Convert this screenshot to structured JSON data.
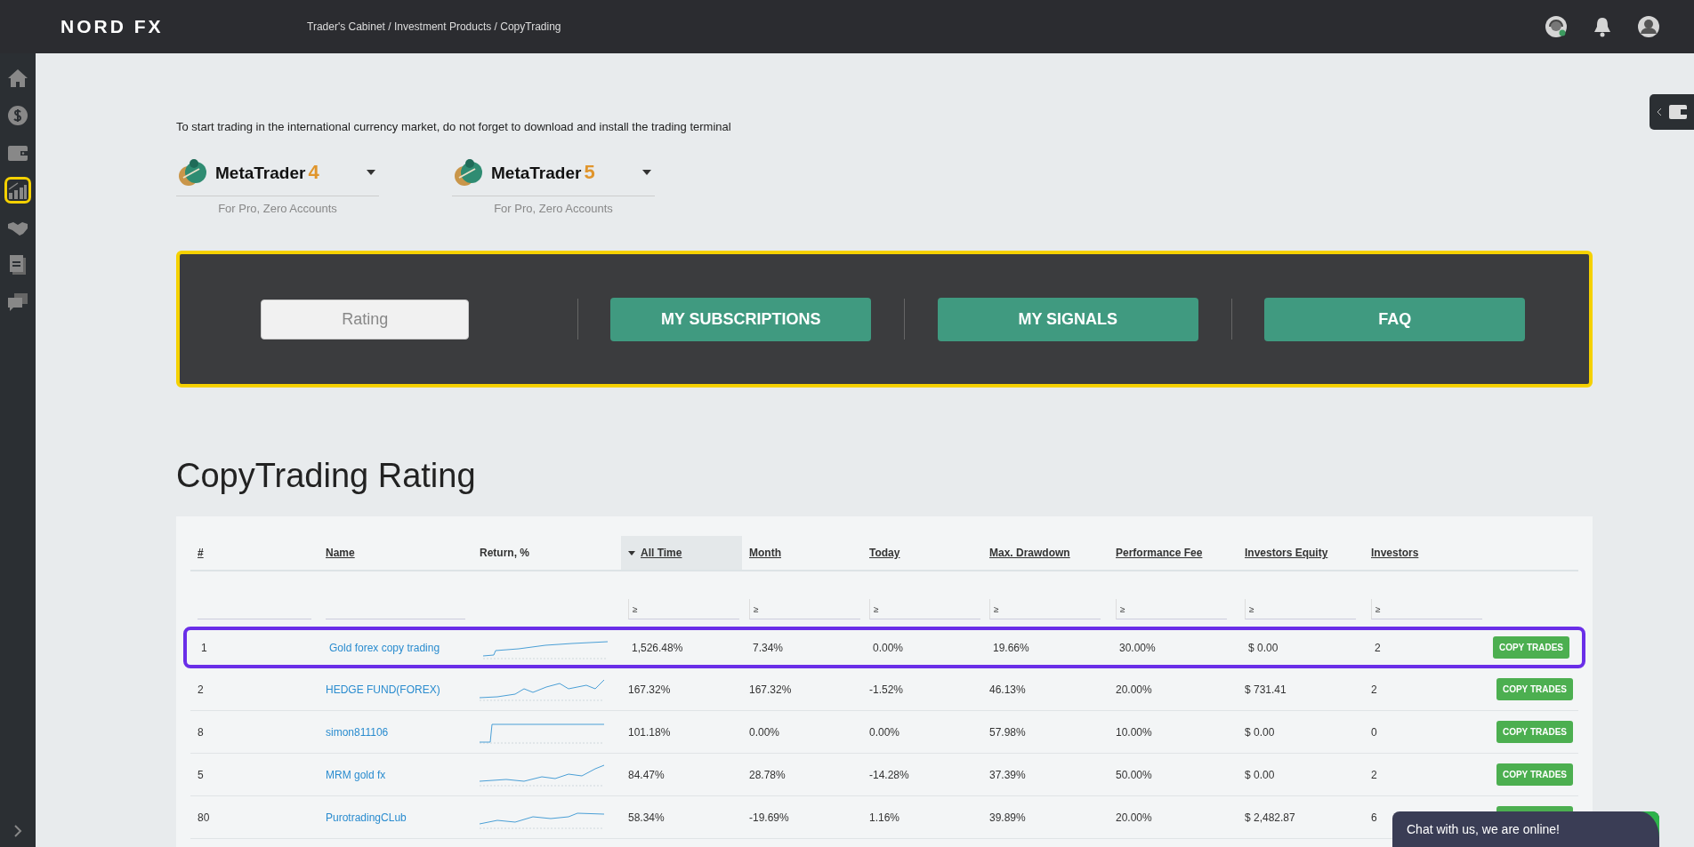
{
  "header": {
    "logo": "NORD FX",
    "breadcrumb": "Trader's Cabinet / Investment Products / CopyTrading"
  },
  "sidebar": {
    "items": [
      {
        "kind": "home",
        "selected": false
      },
      {
        "kind": "dollar",
        "selected": false
      },
      {
        "kind": "wallet",
        "selected": false
      },
      {
        "kind": "chart",
        "selected": true
      },
      {
        "kind": "handshake",
        "selected": false
      },
      {
        "kind": "document",
        "selected": false
      },
      {
        "kind": "chat",
        "selected": false
      }
    ]
  },
  "intro": "To start trading in the international currency market, do not forget to download and install the trading terminal",
  "terminals": [
    {
      "name": "MetaTrader",
      "version": "4",
      "note": "For Pro, Zero Accounts"
    },
    {
      "name": "MetaTrader",
      "version": "5",
      "note": "For Pro, Zero Accounts"
    }
  ],
  "tabs": [
    {
      "label": "Rating",
      "selected": true
    },
    {
      "label": "MY SUBSCRIPTIONS",
      "selected": false
    },
    {
      "label": "MY SIGNALS",
      "selected": false
    },
    {
      "label": "FAQ",
      "selected": false
    }
  ],
  "heading": "CopyTrading Rating",
  "table": {
    "columns": [
      {
        "label": "#",
        "kind": "text"
      },
      {
        "label": "Name",
        "kind": "text"
      },
      {
        "label": "Return, %",
        "kind": "none"
      },
      {
        "label": "All Time",
        "kind": "range",
        "sign": "≥",
        "sorted": true
      },
      {
        "label": "Month",
        "kind": "range",
        "sign": "≥",
        "sorted": false
      },
      {
        "label": "Today",
        "kind": "range",
        "sign": "≥",
        "sorted": false
      },
      {
        "label": "Max. Drawdown",
        "kind": "range",
        "sign": "≥",
        "sorted": false
      },
      {
        "label": "Performance Fee",
        "kind": "range",
        "sign": "≥",
        "sorted": false
      },
      {
        "label": "Investors Equity",
        "kind": "range",
        "sign": "≥",
        "sorted": false
      },
      {
        "label": "Investors",
        "kind": "range",
        "sign": "≥",
        "sorted": false
      }
    ],
    "rows": [
      {
        "rank": "1",
        "name": "Gold forex copy trading",
        "all_time": "1,526.48%",
        "month": "7.34%",
        "today": "0.00%",
        "drawdown": "19.66%",
        "fee": "30.00%",
        "equity": "$ 0.00",
        "investors": "2",
        "action": "COPY TRADES",
        "highlighted": true
      },
      {
        "rank": "2",
        "name": "HEDGE FUND(FOREX)",
        "all_time": "167.32%",
        "month": "167.32%",
        "today": "-1.52%",
        "drawdown": "46.13%",
        "fee": "20.00%",
        "equity": "$ 731.41",
        "investors": "2",
        "action": "COPY TRADES",
        "highlighted": false
      },
      {
        "rank": "8",
        "name": "simon811106",
        "all_time": "101.18%",
        "month": "0.00%",
        "today": "0.00%",
        "drawdown": "57.98%",
        "fee": "10.00%",
        "equity": "$ 0.00",
        "investors": "0",
        "action": "COPY TRADES",
        "highlighted": false
      },
      {
        "rank": "5",
        "name": "MRM gold fx",
        "all_time": "84.47%",
        "month": "28.78%",
        "today": "-14.28%",
        "drawdown": "37.39%",
        "fee": "50.00%",
        "equity": "$ 0.00",
        "investors": "2",
        "action": "COPY TRADES",
        "highlighted": false
      },
      {
        "rank": "80",
        "name": "PurotradingCLub",
        "all_time": "58.34%",
        "month": "-19.69%",
        "today": "1.16%",
        "drawdown": "39.89%",
        "fee": "20.00%",
        "equity": "$ 2,482.87",
        "investors": "6",
        "highlighted": false
      }
    ]
  },
  "chat": {
    "label": "Chat with us, we are online!"
  }
}
